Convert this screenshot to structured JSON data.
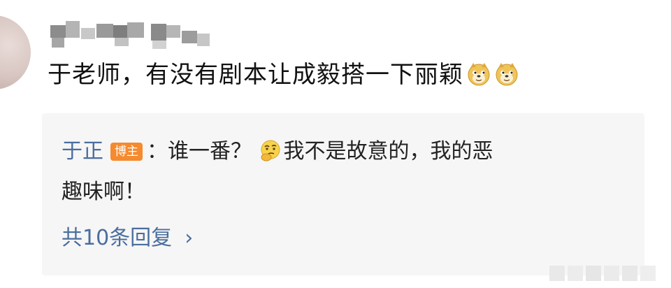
{
  "comment": {
    "author_label": "",
    "text": "于老师，有没有剧本让成毅搭一下丽颖"
  },
  "icons": {
    "emoji_1": "doge-emoji-icon",
    "emoji_2": "doge-emoji-icon",
    "reply_emoji": "thinking-face-emoji-icon",
    "chevron": "chevron-right-icon"
  },
  "reply": {
    "author": "于正",
    "badge": "博主",
    "separator": "：",
    "text_before_emoji": "谁一番？",
    "text_after_emoji": "我不是故意的，我的恶",
    "line2": "趣味啊！",
    "more": "共10条回复",
    "chevron": "›"
  },
  "colors": {
    "link_blue": "#4a6e9e",
    "badge_orange": "#f58a2e",
    "panel_bg": "#f6f6f6"
  }
}
